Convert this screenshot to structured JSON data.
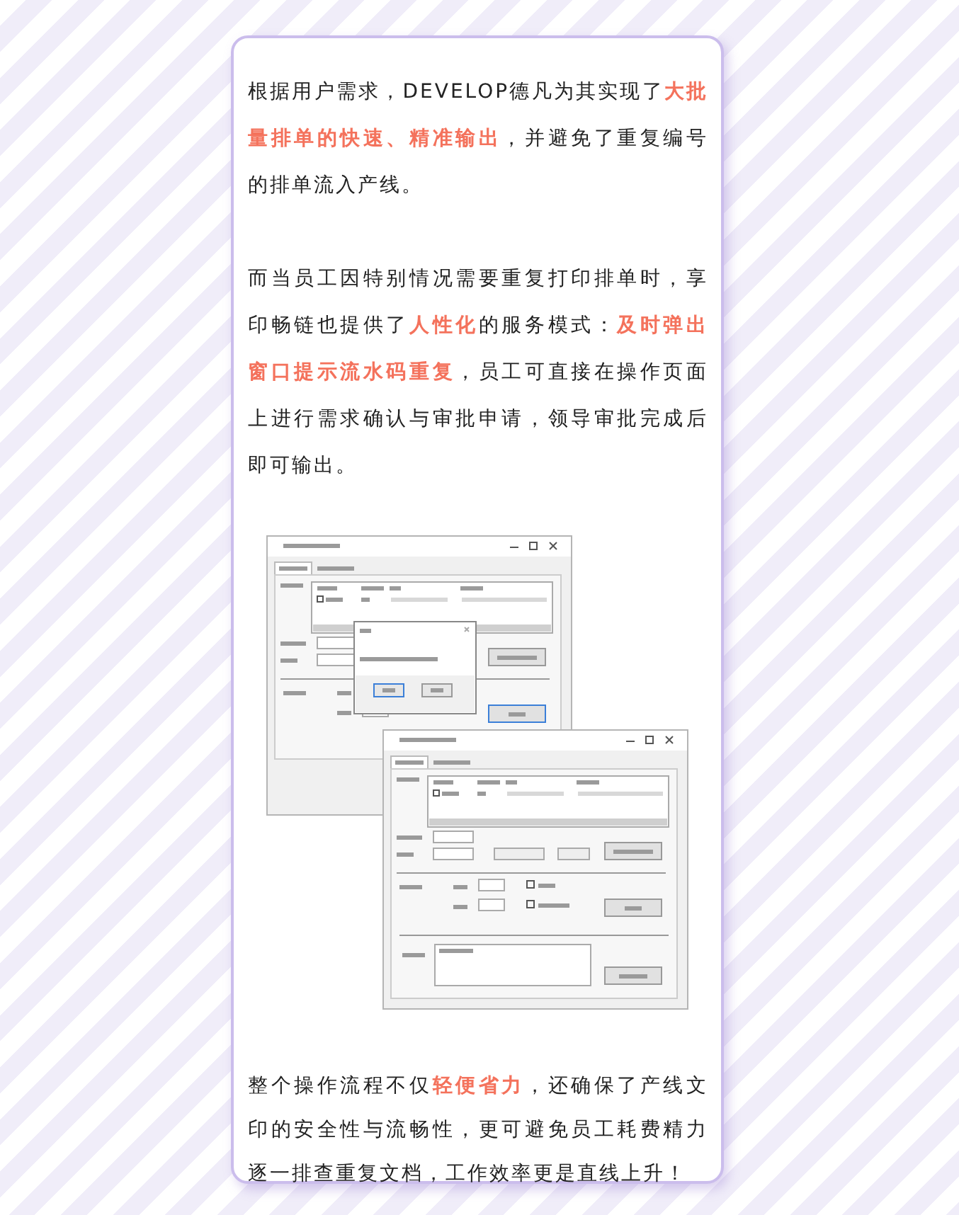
{
  "paragraphs": [
    {
      "text": "根据用户需求，DEVELOP德凡为其实现了**大批量排单的快速、精准输出**，并避免了重复编号的排单流入产线。"
    },
    {
      "text": "而当员工因特别情况需要重复打印排单时，享印畅链也提供了**人性化**的服务模式：**及时弹出窗口提示流水码重复**，员工可直接在操作页面上进行需求确认与审批申请，领导审批完成后即可输出。"
    }
  ],
  "figure": {
    "windows": [
      {
        "dialog": true,
        "approval_panel": false
      },
      {
        "dialog": false,
        "approval_panel": true
      }
    ]
  },
  "closing": {
    "text": "整个操作流程不仅**轻便省力**，还确保了产线文印的安全性与流畅性，更可避免员工耗费精力逐一排查重复文档，工作效率更是直线上升！"
  }
}
